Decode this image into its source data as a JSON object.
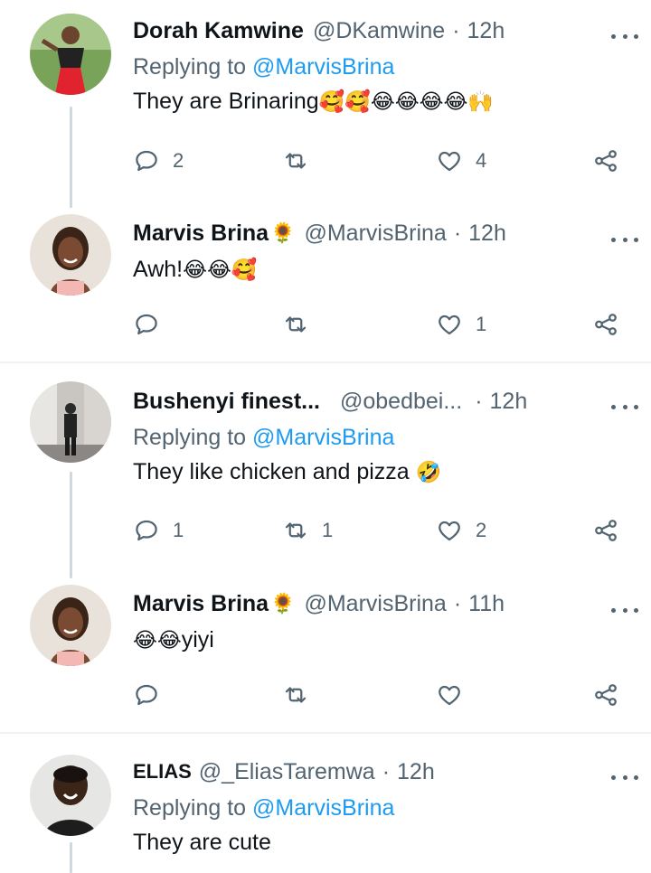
{
  "tweets": [
    {
      "name": "Dorah Kamwine",
      "name_emoji": "",
      "handle": "@DKamwine",
      "handle_truncated": false,
      "time": "12h",
      "replying_prefix": "Replying to ",
      "replying_to": "@MarvisBrina",
      "text": "They are Brinaring",
      "text_emoji": "🥰🥰😂😂😂😂🙌",
      "text_emoji_prefix": "",
      "reply_count": "2",
      "retweet_count": "",
      "like_count": "4",
      "avatar": "woman-in-black-red-outfit-avatar"
    },
    {
      "name": "Marvis Brina",
      "name_emoji": "🌻",
      "handle": "@MarvisBrina",
      "handle_truncated": false,
      "time": "12h",
      "replying_prefix": "",
      "replying_to": "",
      "text": "Awh!",
      "text_emoji": "😂😂🥰",
      "text_emoji_prefix": "",
      "reply_count": "",
      "retweet_count": "",
      "like_count": "1",
      "avatar": "woman-smiling-avatar"
    },
    {
      "name": "Bushenyi finest...",
      "name_emoji": "",
      "handle": "@obedbei",
      "handle_truncated": true,
      "time": "12h",
      "replying_prefix": "Replying to ",
      "replying_to": "@MarvisBrina",
      "text": "They like chicken and pizza ",
      "text_emoji": "🤣",
      "text_emoji_prefix": "",
      "reply_count": "1",
      "retweet_count": "1",
      "like_count": "2",
      "avatar": "man-standing-grayscale-avatar"
    },
    {
      "name": "Marvis Brina",
      "name_emoji": "🌻",
      "handle": "@MarvisBrina",
      "handle_truncated": false,
      "time": "11h",
      "replying_prefix": "",
      "replying_to": "",
      "text": "yiyi",
      "text_emoji": "",
      "text_emoji_prefix": "😂😂",
      "reply_count": "",
      "retweet_count": "",
      "like_count": "",
      "avatar": "woman-smiling-avatar"
    },
    {
      "name": "ELIAS",
      "name_emoji": "",
      "handle": "@_EliasTaremwa",
      "handle_truncated": false,
      "time": "12h",
      "replying_prefix": "Replying to ",
      "replying_to": "@MarvisBrina",
      "text": "They are cute",
      "text_emoji": "",
      "text_emoji_prefix": "",
      "reply_count": "",
      "retweet_count": "",
      "like_count": "",
      "avatar": "young-man-smiling-avatar"
    }
  ],
  "ui": {
    "dot_separator": "·",
    "ellipsis": "...",
    "icons": {
      "reply": "reply-bubble-icon",
      "retweet": "retweet-icon",
      "like": "heart-icon",
      "share": "share-icon",
      "more": "more-dots-icon"
    },
    "colors": {
      "text": "#0f1419",
      "secondary": "#536471",
      "link": "#1d9bf0",
      "thread_line": "#cfd9de",
      "separator": "#eff3f4"
    }
  }
}
